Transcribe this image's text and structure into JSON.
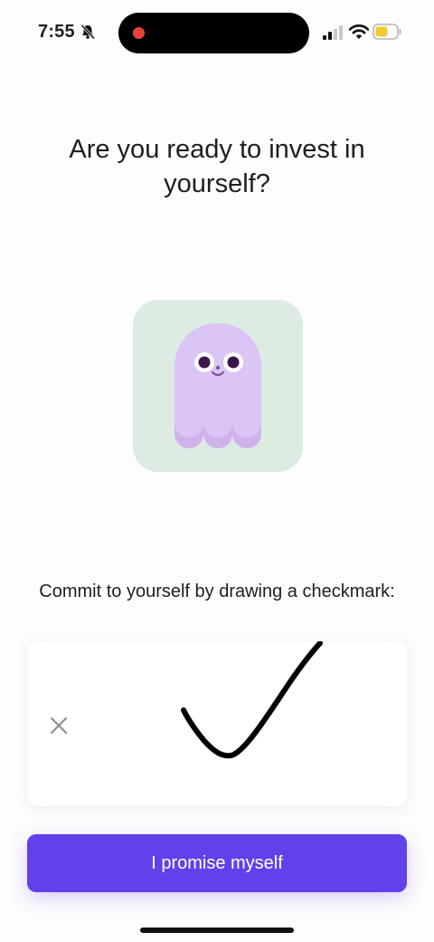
{
  "status_bar": {
    "time": "7:55",
    "icons": [
      "bell-slash-icon",
      "recording-dot-icon",
      "cellular-signal-icon",
      "wifi-icon",
      "battery-icon"
    ],
    "battery_color": "#f4c82f",
    "recording_color": "#e5443a"
  },
  "headline": "Are you ready to invest in yourself?",
  "mascot": {
    "icon": "ghost-mascot-icon",
    "card_color": "#dcece3",
    "body_color": "#d6c0f2"
  },
  "commit": {
    "instruction": "Commit to yourself by drawing a checkmark:",
    "clear_icon": "close-icon"
  },
  "primary_button": {
    "label": "I promise myself",
    "color": "#6241ea"
  }
}
